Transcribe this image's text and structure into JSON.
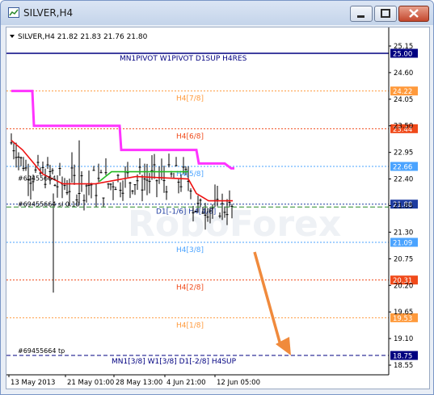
{
  "window": {
    "title": "SILVER,H4",
    "colors": {
      "frame": "#7a96c6",
      "close": "#c4482e"
    }
  },
  "header": {
    "symbol_line": "SILVER,H4  21.82 21.83 21.76 21.80"
  },
  "chart_data": {
    "type": "line",
    "title": "SILVER,H4  21.82 21.83 21.76 21.80",
    "ohlc": {
      "open": 21.82,
      "high": 21.83,
      "low": 21.76,
      "close": 21.8
    },
    "x_ticks": [
      "13 May 2013",
      "21 May 01:00",
      "28 May 13:00",
      "4 Jun 21:00",
      "12 Jun 05:00"
    ],
    "y_ticks": [
      "25.15",
      "24.60",
      "24.05",
      "23.50",
      "22.95",
      "22.40",
      "21.85",
      "21.30",
      "20.75",
      "20.20",
      "19.65",
      "19.10",
      "18.55"
    ],
    "ylim": [
      18.4,
      25.3
    ],
    "grid": false,
    "levels": [
      {
        "price": 25.0,
        "tag": "25.00",
        "label": "MN1PIVOT W1PIVOT D1SUP H4RES",
        "color": "#000080",
        "style": "solid"
      },
      {
        "price": 24.22,
        "tag": "24.22",
        "label": "H4[7/8]",
        "color": "#ff9a3c",
        "style": "dotted"
      },
      {
        "price": 23.44,
        "tag": "23.44",
        "label": "H4[6/8]",
        "color": "#f04a1a",
        "style": "dotted"
      },
      {
        "price": 22.66,
        "tag": "22.66",
        "label": "H4[5/8]",
        "color": "#4aa3ff",
        "style": "dotted"
      },
      {
        "price": 21.88,
        "tag": "21.88",
        "label": "D1[-1/6] H4[4/8]",
        "color": "#1e3ca0",
        "style": "dotted"
      },
      {
        "price": 21.09,
        "tag": "21.09",
        "label": "H4[3/8]",
        "color": "#4aa3ff",
        "style": "dotted"
      },
      {
        "price": 20.31,
        "tag": "20.31",
        "label": "H4[2/8]",
        "color": "#f04a1a",
        "style": "dotted"
      },
      {
        "price": 19.53,
        "tag": "19.53",
        "label": "H4[1/8]",
        "color": "#ff9a3c",
        "style": "dotted"
      },
      {
        "price": 18.75,
        "tag": "18.75",
        "label": "MN1[3/8] W1[3/8] D1[-2/8] H4SUP",
        "color": "#000080",
        "style": "dashed"
      }
    ],
    "current_price": {
      "value": "21.88",
      "hidden_value": "21.80"
    },
    "order_labels": [
      "#69455664",
      "#69455664 sl 0.10",
      "#69455664 tp"
    ],
    "watermark": "RoboForex",
    "arrow_color": "#f08a3c"
  }
}
